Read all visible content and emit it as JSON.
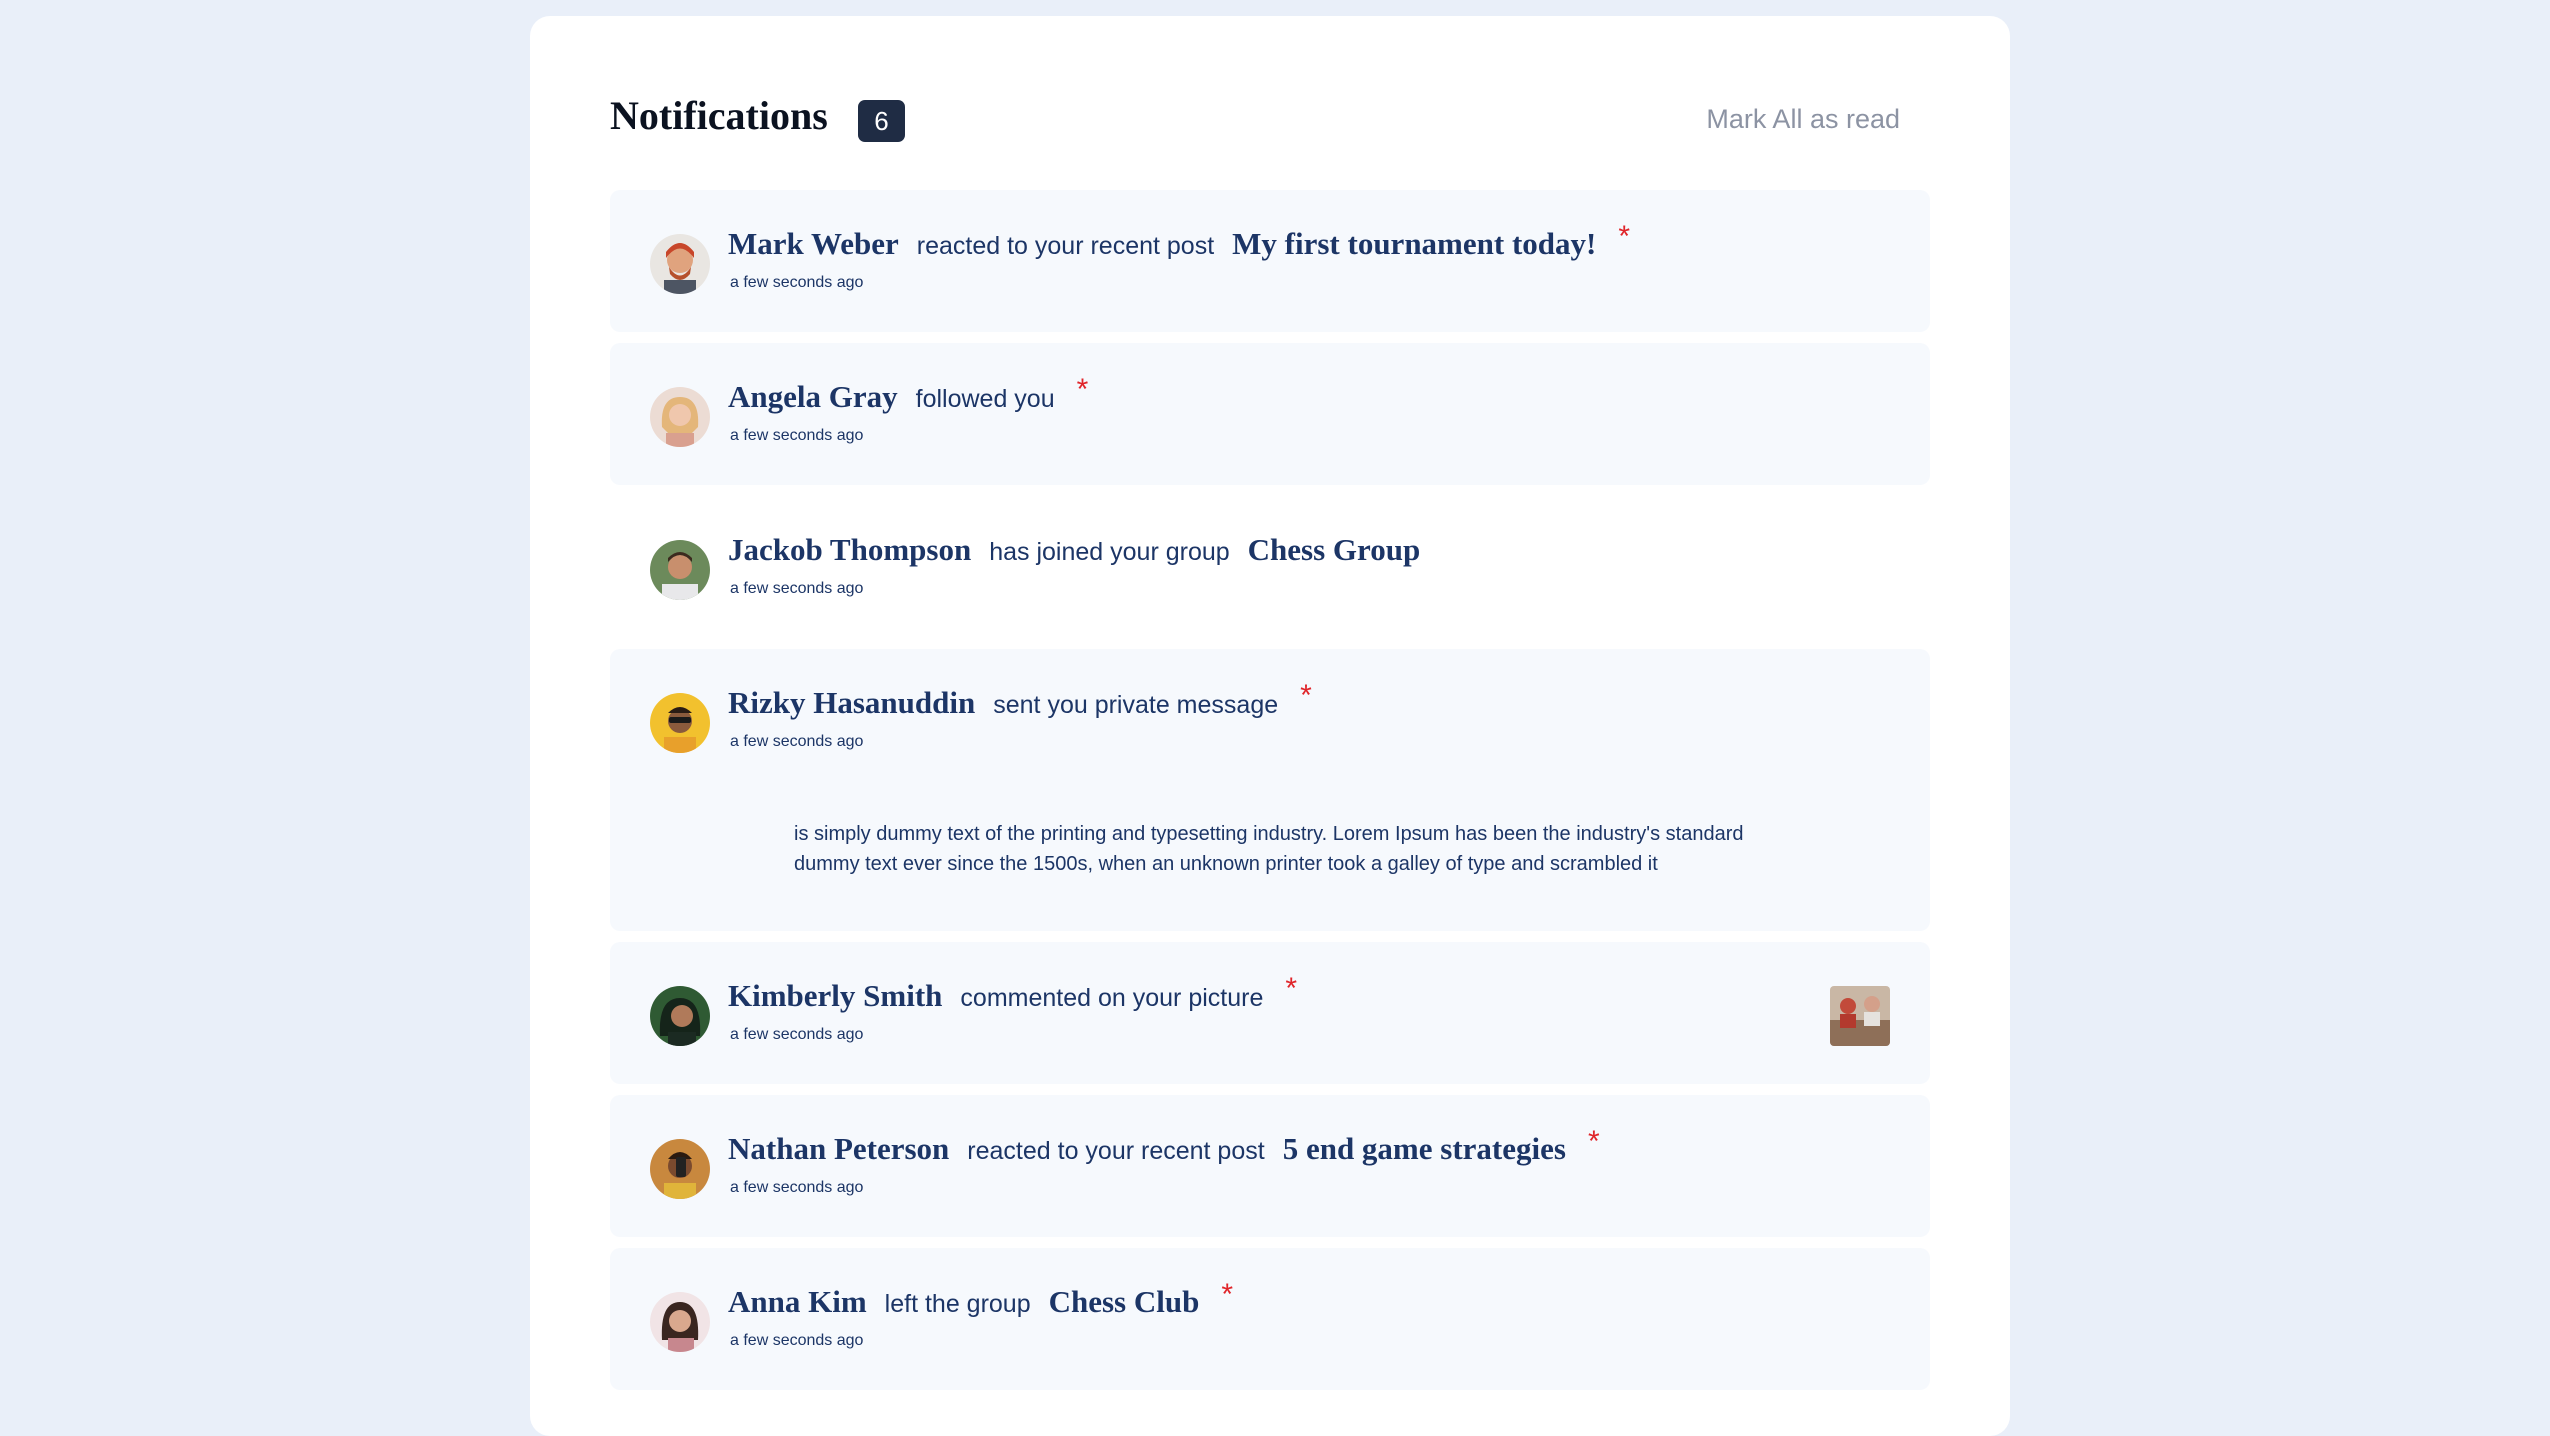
{
  "header": {
    "title": "Notifications",
    "unread_count": "6",
    "mark_all_label": "Mark All as read"
  },
  "notifications": [
    {
      "name": "Mark Weber",
      "action": "reacted to your recent post",
      "target": "My first tournament today!",
      "time": "a few seconds ago",
      "unread": true,
      "unread_marker": "*",
      "avatar": "avatar-mark-weber"
    },
    {
      "name": "Angela Gray",
      "action": "followed you",
      "time": "a few seconds ago",
      "unread": true,
      "unread_marker": "*",
      "avatar": "avatar-angela-gray"
    },
    {
      "name": "Jackob Thompson",
      "action": "has joined your group",
      "target": "Chess Group",
      "time": "a few seconds ago",
      "unread": false,
      "avatar": "avatar-jackob-thompson"
    },
    {
      "name": "Rizky Hasanuddin",
      "action": "sent you private message",
      "time": "a few seconds ago",
      "unread": true,
      "unread_marker": "*",
      "message_line1": "is simply dummy text of the printing and typesetting industry. Lorem Ipsum has been the industry's standard",
      "message_line2": "dummy text ever since the 1500s, when an unknown printer took a galley of type and scrambled it",
      "avatar": "avatar-rizky-hasanuddin"
    },
    {
      "name": "Kimberly Smith",
      "action": "commented on your picture",
      "time": "a few seconds ago",
      "unread": true,
      "unread_marker": "*",
      "thumbnail": "chess-picture-thumbnail",
      "avatar": "avatar-kimberly-smith"
    },
    {
      "name": "Nathan Peterson",
      "action": "reacted to your recent post",
      "target": "5 end game strategies",
      "time": "a few seconds ago",
      "unread": true,
      "unread_marker": "*",
      "avatar": "avatar-nathan-peterson"
    },
    {
      "name": "Anna Kim",
      "action": "left the group",
      "target": "Chess Club",
      "time": "a few seconds ago",
      "unread": true,
      "unread_marker": "*",
      "avatar": "avatar-anna-kim"
    }
  ],
  "colors": {
    "page_background": "#e9eff9",
    "card_background": "#ffffff",
    "unread_background": "#f6f9fd",
    "text_primary": "#1c3566",
    "badge_background": "#1f2c44",
    "unread_marker": "#e0252a",
    "muted": "#8c93a3"
  }
}
